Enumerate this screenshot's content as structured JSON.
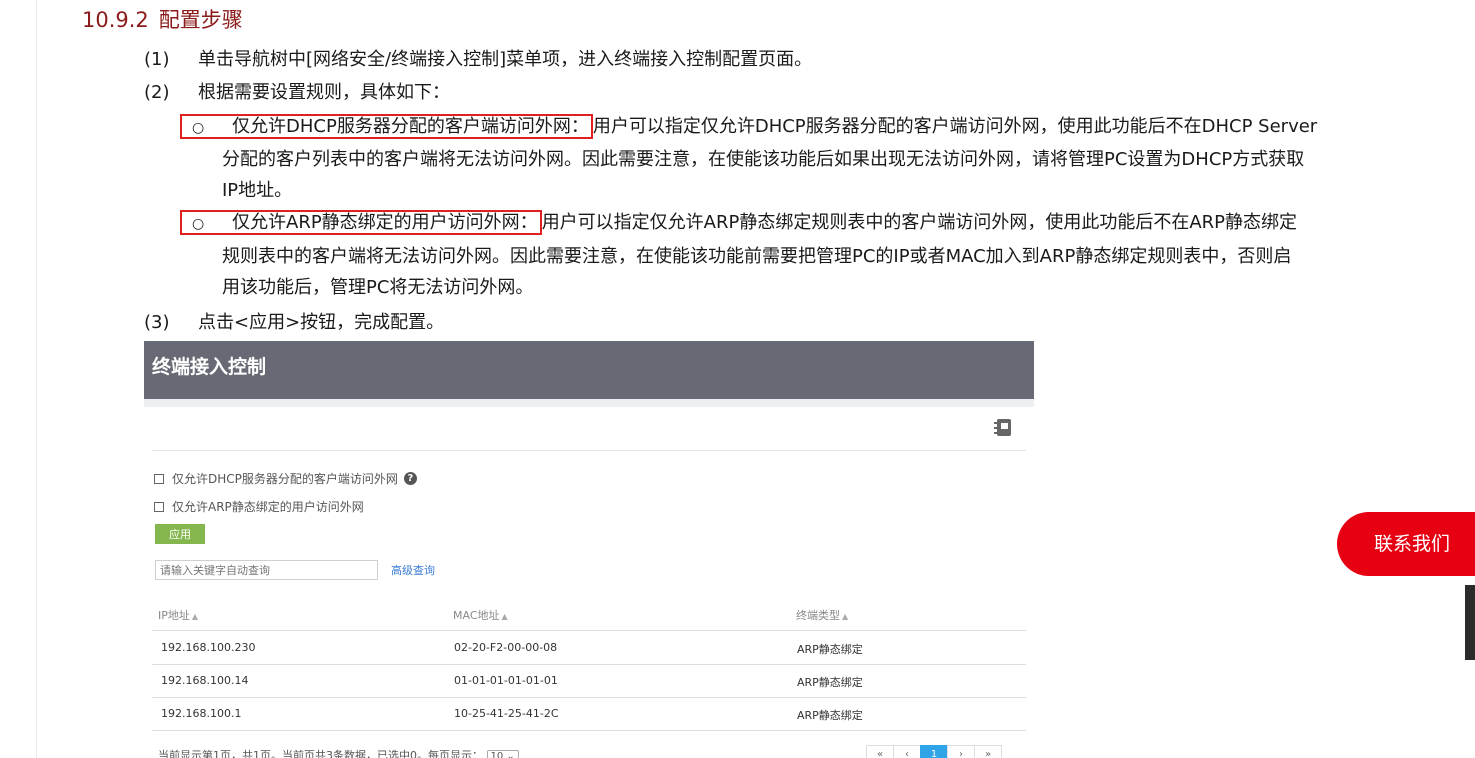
{
  "section": {
    "number": "10.9.2",
    "title": "配置步骤"
  },
  "steps": [
    {
      "num": "(1)",
      "text": "单击导航树中[网络安全/终端接入控制]菜单项，进入终端接入控制配置页面。"
    },
    {
      "num": "(2)",
      "text": "根据需要设置规则，具体如下："
    },
    {
      "num": "(3)",
      "text": "点击<应用>按钮，完成配置。"
    }
  ],
  "bullets": [
    {
      "marker": "○",
      "term": "仅允许DHCP服务器分配的客户端访问外网：",
      "lines": [
        "用户可以指定仅允许DHCP服务器分配的客户端访问外网，使用此功能后不在DHCP Server",
        "分配的客户列表中的客户端将无法访问外网。因此需要注意，在使能该功能后如果出现无法访问外网，请将管理PC设置为DHCP方式获取",
        "IP地址。"
      ]
    },
    {
      "marker": "○",
      "term": "仅允许ARP静态绑定的用户访问外网：",
      "lines": [
        "用户可以指定仅允许ARP静态绑定规则表中的客户端访问外网，使用此功能后不在ARP静态绑定",
        "规则表中的客户端将无法访问外网。因此需要注意，在使能该功能前需要把管理PC的IP或者MAC加入到ARP静态绑定规则表中，否则启",
        "用该功能后，管理PC将无法访问外网。"
      ]
    }
  ],
  "panel": {
    "title": "终端接入控制",
    "options": [
      {
        "label": "仅允许DHCP服务器分配的客户端访问外网",
        "checked": false
      },
      {
        "label": "仅允许ARP静态绑定的用户访问外网",
        "checked": false
      }
    ],
    "apply_label": "应用",
    "search_placeholder": "请输入关键字自动查询",
    "advanced_search_label": "高级查询",
    "columns": [
      "IP地址",
      "MAC地址",
      "终端类型"
    ],
    "rows": [
      [
        "192.168.100.230",
        "02-20-F2-00-00-08",
        "ARP静态绑定"
      ],
      [
        "192.168.100.14",
        "01-01-01-01-01-01",
        "ARP静态绑定"
      ],
      [
        "192.168.100.1",
        "10-25-41-25-41-2C",
        "ARP静态绑定"
      ]
    ],
    "footer_text": "当前显示第1页，共1页。当前页共3条数据，已选中0。每页显示：",
    "page_size": "10",
    "pager": [
      "«",
      "‹",
      "1",
      "›",
      "»"
    ],
    "current_page": "1"
  },
  "contact_label": "联系我们",
  "colors": {
    "title": "#8b1a1a",
    "highlight_border": "#e02020",
    "panel_header": "#676a74",
    "apply": "#83b64c",
    "link": "#3a7bd5",
    "contact": "#e60012"
  },
  "icons": [
    "manual-book-icon",
    "help-icon",
    "sort-ascending-icon",
    "chevron-down-icon"
  ]
}
